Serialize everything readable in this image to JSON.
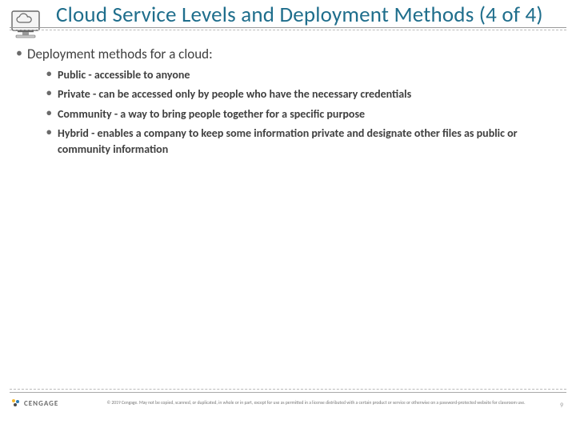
{
  "title": "Cloud Service Levels and Deployment Methods (4 of 4)",
  "icon": "cloud-monitor-icon",
  "primary": {
    "text": "Deployment methods for a cloud:"
  },
  "bullets": [
    "Public - accessible to anyone",
    "Private - can be accessed only by people who have the necessary credentials",
    "Community - a way to bring people together for a specific purpose",
    "Hybrid - enables a company to keep some information private and designate other files as public or community information"
  ],
  "footer": {
    "brand": "CENGAGE",
    "copyright": "© 2019 Cengage. May not be copied, scanned, or duplicated, in whole or in part, except for use as permitted in a license distributed with a certain product or service or otherwise on a password-protected website for classroom use.",
    "page": "9"
  },
  "colors": {
    "title": "#1f6e8c",
    "body": "#404040"
  }
}
